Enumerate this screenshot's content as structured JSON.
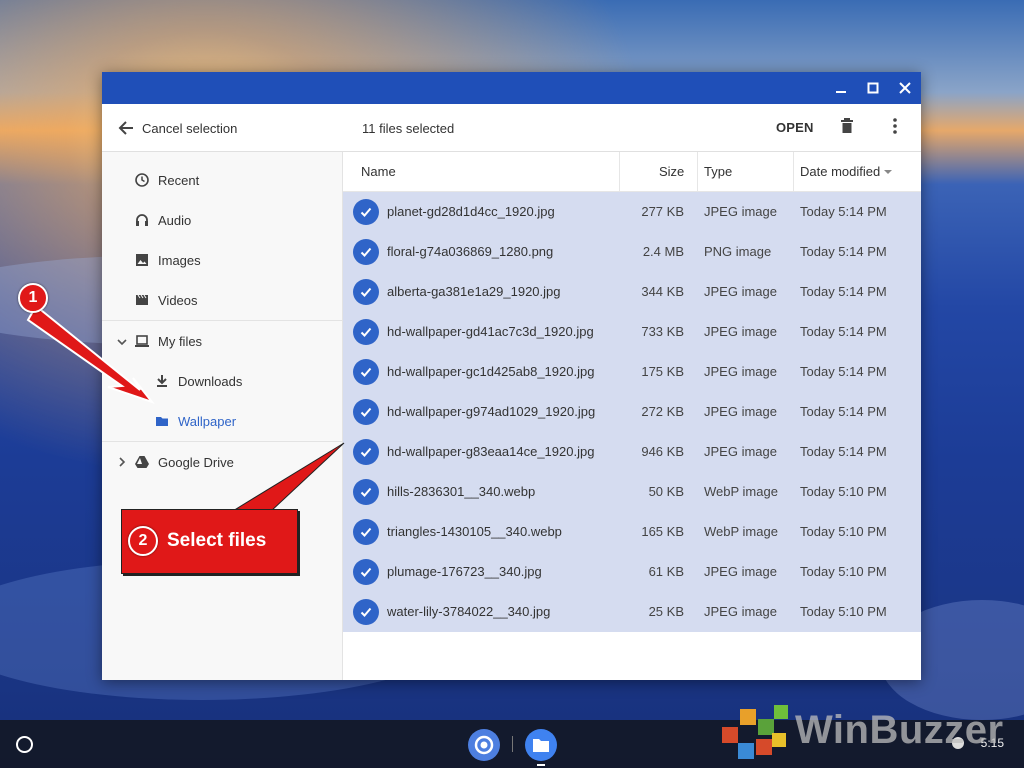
{
  "toolbar": {
    "cancel_label": "Cancel selection",
    "selected_count": "11 files selected",
    "open_label": "OPEN"
  },
  "sidebar": {
    "items": [
      {
        "label": "Recent",
        "icon": "clock-icon"
      },
      {
        "label": "Audio",
        "icon": "headphones-icon"
      },
      {
        "label": "Images",
        "icon": "image-icon"
      },
      {
        "label": "Videos",
        "icon": "video-icon"
      },
      {
        "label": "My files",
        "icon": "laptop-icon"
      },
      {
        "label": "Downloads",
        "icon": "download-icon"
      },
      {
        "label": "Wallpaper",
        "icon": "folder-icon",
        "active": true
      },
      {
        "label": "Google Drive",
        "icon": "drive-icon"
      }
    ]
  },
  "table": {
    "headers": {
      "name": "Name",
      "size": "Size",
      "type": "Type",
      "date": "Date modified"
    },
    "rows": [
      {
        "name": "planet-gd28d1d4cc_1920.jpg",
        "size": "277 KB",
        "type": "JPEG image",
        "date": "Today 5:14 PM"
      },
      {
        "name": "floral-g74a036869_1280.png",
        "size": "2.4 MB",
        "type": "PNG image",
        "date": "Today 5:14 PM"
      },
      {
        "name": "alberta-ga381e1a29_1920.jpg",
        "size": "344 KB",
        "type": "JPEG image",
        "date": "Today 5:14 PM"
      },
      {
        "name": "hd-wallpaper-gd41ac7c3d_1920.jpg",
        "size": "733 KB",
        "type": "JPEG image",
        "date": "Today 5:14 PM"
      },
      {
        "name": "hd-wallpaper-gc1d425ab8_1920.jpg",
        "size": "175 KB",
        "type": "JPEG image",
        "date": "Today 5:14 PM"
      },
      {
        "name": "hd-wallpaper-g974ad1029_1920.jpg",
        "size": "272 KB",
        "type": "JPEG image",
        "date": "Today 5:14 PM"
      },
      {
        "name": "hd-wallpaper-g83eaa14ce_1920.jpg",
        "size": "946 KB",
        "type": "JPEG image",
        "date": "Today 5:14 PM"
      },
      {
        "name": "hills-2836301__340.webp",
        "size": "50 KB",
        "type": "WebP image",
        "date": "Today 5:10 PM"
      },
      {
        "name": "triangles-1430105__340.webp",
        "size": "165 KB",
        "type": "WebP image",
        "date": "Today 5:10 PM"
      },
      {
        "name": "plumage-176723__340.jpg",
        "size": "61 KB",
        "type": "JPEG image",
        "date": "Today 5:10 PM"
      },
      {
        "name": "water-lily-3784022__340.jpg",
        "size": "25 KB",
        "type": "JPEG image",
        "date": "Today 5:10 PM"
      }
    ]
  },
  "annotations": {
    "step1": "1",
    "step2": "2",
    "callout": "Select files"
  },
  "shelf": {
    "clock": "5:15"
  },
  "watermark": "WinBuzzer",
  "colors": {
    "titlebar": "#1f4fb8",
    "selected_row": "#d5dcf0",
    "accent": "#2f64c8",
    "annotation": "#e01818"
  }
}
